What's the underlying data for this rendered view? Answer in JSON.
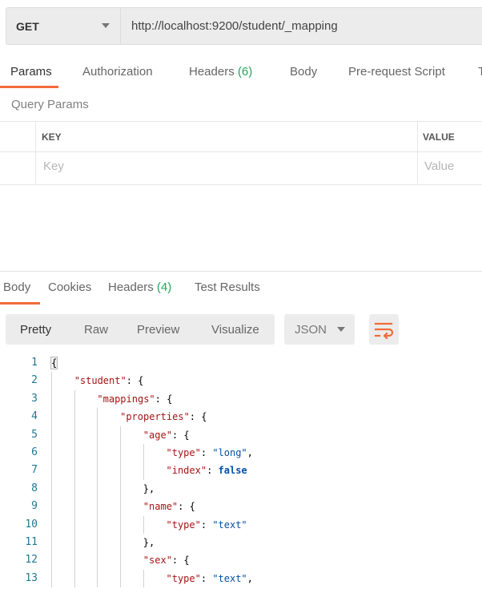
{
  "request": {
    "method": "GET",
    "url": "http://localhost:9200/student/_mapping",
    "tabs": [
      {
        "label": "Params",
        "count": "",
        "active": true
      },
      {
        "label": "Authorization",
        "count": ""
      },
      {
        "label": "Headers",
        "count": "(6)"
      },
      {
        "label": "Body",
        "count": ""
      },
      {
        "label": "Pre-request Script",
        "count": ""
      },
      {
        "label": "T",
        "count": ""
      }
    ],
    "query_params_title": "Query Params",
    "table": {
      "headers": [
        "KEY",
        "VALUE"
      ],
      "placeholders": [
        "Key",
        "Value"
      ]
    }
  },
  "response": {
    "tabs": [
      {
        "label": "Body",
        "count": "",
        "active": true
      },
      {
        "label": "Cookies",
        "count": ""
      },
      {
        "label": "Headers",
        "count": "(4)"
      },
      {
        "label": "Test Results",
        "count": ""
      }
    ],
    "view_modes": [
      "Pretty",
      "Raw",
      "Preview",
      "Visualize"
    ],
    "active_view": "Pretty",
    "format": "JSON",
    "wrap_icon": "wrap-lines-icon",
    "code_lines": [
      {
        "n": "1",
        "indent": 0,
        "tokens": [
          [
            "p",
            "{"
          ]
        ]
      },
      {
        "n": "2",
        "indent": 1,
        "tokens": [
          [
            "k",
            "\"student\""
          ],
          [
            "p",
            ": {"
          ]
        ]
      },
      {
        "n": "3",
        "indent": 2,
        "tokens": [
          [
            "k",
            "\"mappings\""
          ],
          [
            "p",
            ": {"
          ]
        ]
      },
      {
        "n": "4",
        "indent": 3,
        "tokens": [
          [
            "k",
            "\"properties\""
          ],
          [
            "p",
            ": {"
          ]
        ]
      },
      {
        "n": "5",
        "indent": 4,
        "tokens": [
          [
            "k",
            "\"age\""
          ],
          [
            "p",
            ": {"
          ]
        ]
      },
      {
        "n": "6",
        "indent": 5,
        "tokens": [
          [
            "k",
            "\"type\""
          ],
          [
            "p",
            ": "
          ],
          [
            "s",
            "\"long\""
          ],
          [
            "p",
            ","
          ]
        ]
      },
      {
        "n": "7",
        "indent": 5,
        "tokens": [
          [
            "k",
            "\"index\""
          ],
          [
            "p",
            ": "
          ],
          [
            "b",
            "false"
          ]
        ]
      },
      {
        "n": "8",
        "indent": 4,
        "tokens": [
          [
            "p",
            "},"
          ]
        ]
      },
      {
        "n": "9",
        "indent": 4,
        "tokens": [
          [
            "k",
            "\"name\""
          ],
          [
            "p",
            ": {"
          ]
        ]
      },
      {
        "n": "10",
        "indent": 5,
        "tokens": [
          [
            "k",
            "\"type\""
          ],
          [
            "p",
            ": "
          ],
          [
            "s",
            "\"text\""
          ]
        ]
      },
      {
        "n": "11",
        "indent": 4,
        "tokens": [
          [
            "p",
            "},"
          ]
        ]
      },
      {
        "n": "12",
        "indent": 4,
        "tokens": [
          [
            "k",
            "\"sex\""
          ],
          [
            "p",
            ": {"
          ]
        ]
      },
      {
        "n": "13",
        "indent": 5,
        "tokens": [
          [
            "k",
            "\"type\""
          ],
          [
            "p",
            ": "
          ],
          [
            "s",
            "\"text\""
          ],
          [
            "p",
            ","
          ]
        ]
      }
    ]
  },
  "colors": {
    "accent": "#f26b3a",
    "count": "#26a55a",
    "key": "#a31515",
    "string": "#0451a5",
    "line_number": "#237893"
  }
}
